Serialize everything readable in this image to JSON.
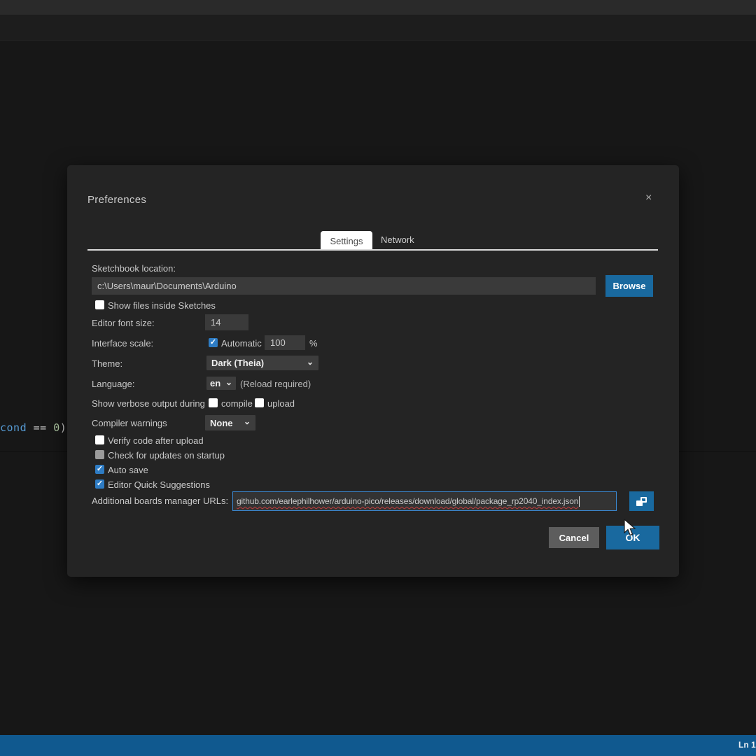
{
  "colors": {
    "accent_blue": "#19699f",
    "checkbox_checked_blue": "#2e7cc4",
    "focus_border_blue": "#3b8bd6",
    "squiggle_red": "#c23c3c",
    "status_bar_blue": "#10598f",
    "active_tab_bg": "#ffffff",
    "dialog_bg": "#242424"
  },
  "icons": {
    "chevron_down": "⌄",
    "check": "✓"
  },
  "editor": {
    "code": {
      "t1": "cond",
      "t2": " == ",
      "t3": "0",
      "t4": ") {"
    }
  },
  "statusbar": {
    "line_info": "Ln 1"
  },
  "dialog": {
    "title": "Preferences",
    "close_label": "×",
    "tabs": {
      "settings": "Settings",
      "network": "Network"
    },
    "sketchbook": {
      "label": "Sketchbook location:",
      "value": "c:\\Users\\maur\\Documents\\Arduino",
      "browse_label": "Browse"
    },
    "show_files": {
      "label": "Show files inside Sketches",
      "checked": false
    },
    "font_size": {
      "label": "Editor font size:",
      "value": "14"
    },
    "interface_scale": {
      "label": "Interface scale:",
      "auto_label": "Automatic",
      "auto_checked": true,
      "value": "100",
      "unit": "%"
    },
    "theme": {
      "label": "Theme:",
      "value": "Dark (Theia)"
    },
    "language": {
      "label": "Language:",
      "value": "en",
      "note": "(Reload required)"
    },
    "verbose": {
      "label": "Show verbose output during",
      "compile_label": "compile",
      "compile_checked": false,
      "upload_label": "upload",
      "upload_checked": false
    },
    "compiler_warnings": {
      "label": "Compiler warnings",
      "value": "None"
    },
    "checks": [
      {
        "label": "Verify code after upload",
        "state": "unchecked"
      },
      {
        "label": "Check for updates on startup",
        "state": "gray"
      },
      {
        "label": "Auto save",
        "state": "checked"
      },
      {
        "label": "Editor Quick Suggestions",
        "state": "checked"
      }
    ],
    "boards_urls": {
      "label": "Additional boards manager URLs:",
      "value": "github.com/earlephilhower/arduino-pico/releases/download/global/package_rp2040_index.json"
    },
    "buttons": {
      "cancel": "Cancel",
      "ok": "OK"
    }
  }
}
